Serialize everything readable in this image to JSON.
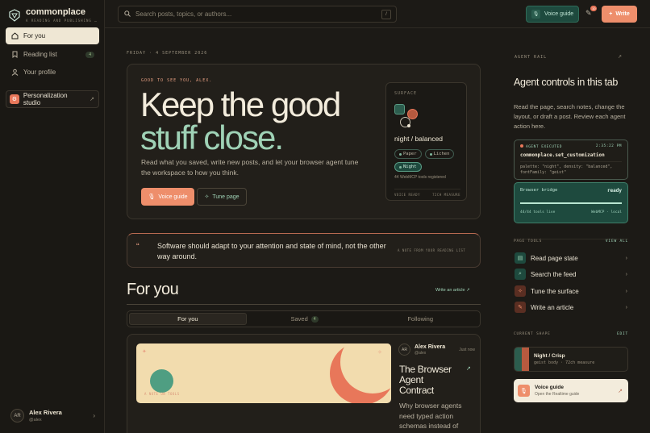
{
  "brand": {
    "name": "commonplace",
    "tagline": "A READING AND PUBLISHING …"
  },
  "sidebar": {
    "items": [
      {
        "label": "For you"
      },
      {
        "label": "Reading list",
        "count": "4"
      },
      {
        "label": "Your profile"
      }
    ],
    "personalization": "Personalization studio",
    "user": {
      "initials": "AR",
      "name": "Alex Rivera",
      "handle": "@alex"
    }
  },
  "topbar": {
    "search_placeholder": "Search posts, topics, or authors...",
    "shortcut": "/",
    "voice_label": "Voice guide",
    "notif_count": "10",
    "write_label": "Write"
  },
  "main": {
    "date": "FRIDAY · 4 SEPTEMBER 2026",
    "hero": {
      "greeting": "GOOD TO SEE YOU, ALEX.",
      "title1": "Keep the good",
      "title2": "stuff close.",
      "description": "Read what you saved, write new posts, and let your browser agent tune the workspace to how you think.",
      "btn_voice": "Voice guide",
      "btn_tune": "Tune page"
    },
    "surface": {
      "label": "SURFACE",
      "name": "night / balanced",
      "chips": [
        "Paper",
        "Lichen",
        "Night"
      ],
      "tools": "44 WebMCP tools registered",
      "footer_left": "VOICE READY",
      "footer_right": "72CH MEASURE"
    },
    "quote": {
      "text": "Software should adapt to your attention and state of mind, not the other way around.",
      "source": "A NOTE FROM YOUR READING LIST"
    },
    "for_you": "For you",
    "write_article": "Write an article",
    "tabs": [
      {
        "label": "For you"
      },
      {
        "label": "Saved",
        "count": "4"
      },
      {
        "label": "Following"
      }
    ],
    "card": {
      "author": "Alex Rivera",
      "handle": "@alex",
      "time": "Just now",
      "title": "The Browser Agent Contract",
      "excerpt": "Why browser agents need typed action schemas instead of",
      "image_caption": "A NOTE ON TOOLS"
    }
  },
  "rail": {
    "label": "AGENT RAIL",
    "title": "Agent controls in this tab",
    "description": "Read the page, search notes, change the layout, or draft a post. Review each agent action here.",
    "exec": {
      "label": "AGENT EXECUTED",
      "time": "2:35:22 PM",
      "fn": "commonplace.set_customization",
      "params": "palette: \"night\", density: \"balanced\", fontFamily: \"geist\""
    },
    "bridge": {
      "label": "Browser bridge",
      "status": "ready",
      "progress": 1.0,
      "tools": "44/44 tools live",
      "mode": "WebMCP · local"
    },
    "page_tools": {
      "label": "PAGE TOOLS",
      "view_all": "VIEW ALL",
      "items": [
        "Read page state",
        "Search the feed",
        "Tune the surface",
        "Write an article"
      ]
    },
    "shape": {
      "label": "CURRENT SHAPE",
      "edit": "EDIT",
      "name": "Night / Crisp",
      "detail": "geist body · 72ch measure"
    },
    "voice": {
      "name": "Voice guide",
      "detail": "Open the Realtime guide"
    }
  },
  "colors": {
    "accent": "#ee8e6b",
    "green": "#1e4a3e",
    "mint": "#9fd2b6",
    "bg": "#1c1a16"
  }
}
